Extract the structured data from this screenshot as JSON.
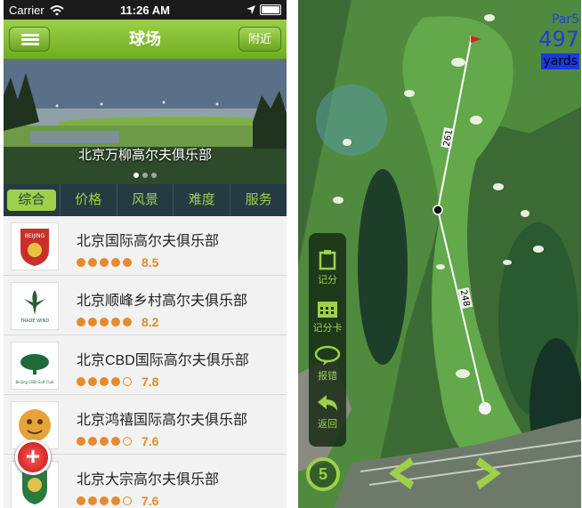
{
  "left_phone": {
    "status": {
      "carrier": "Carrier",
      "time": "11:26 AM"
    },
    "navbar": {
      "title": "球场",
      "nearby": "附近"
    },
    "banner": {
      "caption": "北京万柳高尔夫俱乐部"
    },
    "tabs": [
      "综合",
      "价格",
      "风景",
      "难度",
      "服务"
    ],
    "courses": [
      {
        "name": "北京国际高尔夫俱乐部",
        "stars": 5,
        "score": "8.5"
      },
      {
        "name": "北京顺峰乡村高尔夫俱乐部",
        "stars": 5,
        "score": "8.2"
      },
      {
        "name": "北京CBD国际高尔夫俱乐部",
        "stars": 4,
        "score": "7.8"
      },
      {
        "name": "北京鸿禧国际高尔夫俱乐部",
        "stars": 4,
        "score": "7.6"
      },
      {
        "name": "北京大宗高尔夫俱乐部",
        "stars": 4,
        "score": "7.6"
      }
    ],
    "add_button": "+"
  },
  "right_phone": {
    "par": "Par5",
    "distance": "497",
    "unit": "yards",
    "segment_distances": [
      "261",
      "248"
    ],
    "sidebar": [
      {
        "label": "记分",
        "icon": "clipboard-icon"
      },
      {
        "label": "记分卡",
        "icon": "calendar-icon"
      },
      {
        "label": "报错",
        "icon": "speech-bubble-icon"
      },
      {
        "label": "返回",
        "icon": "back-arrow-icon"
      }
    ],
    "hole_number": "5"
  },
  "colors": {
    "accent_green": "#9ed04b",
    "tab_bar": "#253a42",
    "star_orange": "#e68a2e",
    "yardage_blue": "#1f3cdc"
  }
}
